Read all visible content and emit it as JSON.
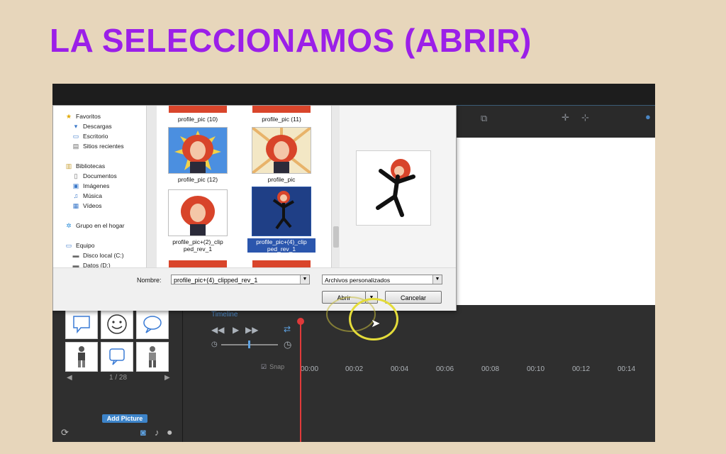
{
  "slide": {
    "title": "LA SELECCIONAMOS (ABRIR)"
  },
  "colors": {
    "title": "#9b1fe8",
    "slide_bg": "#e7d6bb",
    "selection": "#2b56ad",
    "annotation_ring": "#e4dc3a",
    "playhead": "#e03a3a",
    "accent_blue": "#3d84c9"
  },
  "dialog": {
    "nav": [
      {
        "label": "Favoritos",
        "icon": "star-icon"
      },
      {
        "label": "Descargas",
        "icon": "download-folder-icon"
      },
      {
        "label": "Escritorio",
        "icon": "desktop-icon"
      },
      {
        "label": "Sitios recientes",
        "icon": "recent-places-icon"
      },
      {
        "label": "Bibliotecas",
        "icon": "libraries-icon"
      },
      {
        "label": "Documentos",
        "icon": "documents-icon"
      },
      {
        "label": "Imágenes",
        "icon": "pictures-icon"
      },
      {
        "label": "Música",
        "icon": "music-icon"
      },
      {
        "label": "Vídeos",
        "icon": "videos-icon"
      },
      {
        "label": "Grupo en el hogar",
        "icon": "homegroup-icon"
      },
      {
        "label": "Equipo",
        "icon": "computer-icon"
      },
      {
        "label": "Disco local (C:)",
        "icon": "drive-icon"
      },
      {
        "label": "Datos (D:)",
        "icon": "drive-icon"
      }
    ],
    "files": [
      {
        "name": "profile_pic (10)",
        "selected": false
      },
      {
        "name": "profile_pic (11)",
        "selected": false
      },
      {
        "name": "profile_pic (12)",
        "selected": false
      },
      {
        "name": "profile_pic",
        "selected": false
      },
      {
        "name_line1": "profile_pic+(2)_clip",
        "name_line2": "ped_rev_1",
        "selected": false
      },
      {
        "name_line1": "profile_pic+(4)_clip",
        "name_line2": "ped_rev_1",
        "selected": true
      }
    ],
    "name_label": "Nombre:",
    "filename_value": "profile_pic+(4)_clipped_rev_1",
    "filetype_value": "Archivos personalizados",
    "open_button": "Abrir",
    "cancel_button": "Cancelar"
  },
  "editor": {
    "timeline_label": "Timeline",
    "snap_label": "Snap",
    "ticks": [
      "00:00",
      "00:02",
      "00:04",
      "00:06",
      "00:08",
      "00:10",
      "00:12",
      "00:14"
    ],
    "pager": "1 / 28",
    "add_picture": "Add Picture"
  }
}
